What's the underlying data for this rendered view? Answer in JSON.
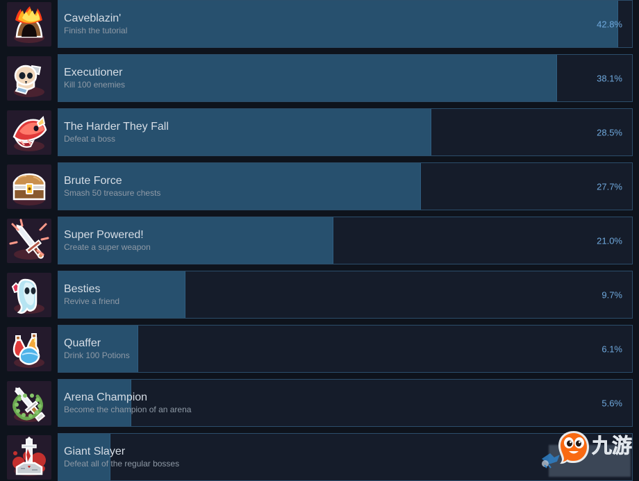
{
  "page": {
    "title": "Steam Global Achievement Stats",
    "background_color": "#0e131c"
  },
  "colors": {
    "track_bg": "#151c2a",
    "track_border": "#2c4e6b",
    "fill": "#27506e",
    "title_text": "#d6dde5",
    "desc_text": "#8f9aa6",
    "percent_text": "#6fa8dc",
    "icon_tile_bg": "#241a2c",
    "watermark_orange": "#f96a12"
  },
  "watermark": {
    "text": "九游",
    "mascot": "orange-blob-mascot-icon",
    "bird": "blue-bird-icon"
  },
  "achievements": [
    {
      "name": "Caveblazin'",
      "description": "Finish the tutorial",
      "percent": "42.8%",
      "percent_value": 42.8,
      "icon": "flaming-cave-entrance-icon"
    },
    {
      "name": "Executioner",
      "description": "Kill 100 enemies",
      "percent": "38.1%",
      "percent_value": 38.1,
      "icon": "skull-and-axe-icon"
    },
    {
      "name": "The Harder They Fall",
      "description": "Defeat a boss",
      "percent": "28.5%",
      "percent_value": 28.5,
      "icon": "red-boss-monster-icon"
    },
    {
      "name": "Brute Force",
      "description": "Smash 50 treasure chests",
      "percent": "27.7%",
      "percent_value": 27.7,
      "icon": "treasure-chest-icon"
    },
    {
      "name": "Super Powered!",
      "description": "Create a super weapon",
      "percent": "21.0%",
      "percent_value": 21.0,
      "icon": "glowing-sword-icon"
    },
    {
      "name": "Besties",
      "description": "Revive a friend",
      "percent": "9.7%",
      "percent_value": 9.7,
      "icon": "ghost-with-heart-icon"
    },
    {
      "name": "Quaffer",
      "description": "Drink 100 Potions",
      "percent": "6.1%",
      "percent_value": 6.1,
      "icon": "potion-bottles-icon"
    },
    {
      "name": "Arena Champion",
      "description": "Become the champion of an arena",
      "percent": "5.6%",
      "percent_value": 5.6,
      "icon": "sword-and-laurel-wreath-icon"
    },
    {
      "name": "Giant Slayer",
      "description": "Defeat all of the regular bosses",
      "percent": "",
      "percent_value": 4.0,
      "icon": "sword-in-stone-icon"
    }
  ]
}
